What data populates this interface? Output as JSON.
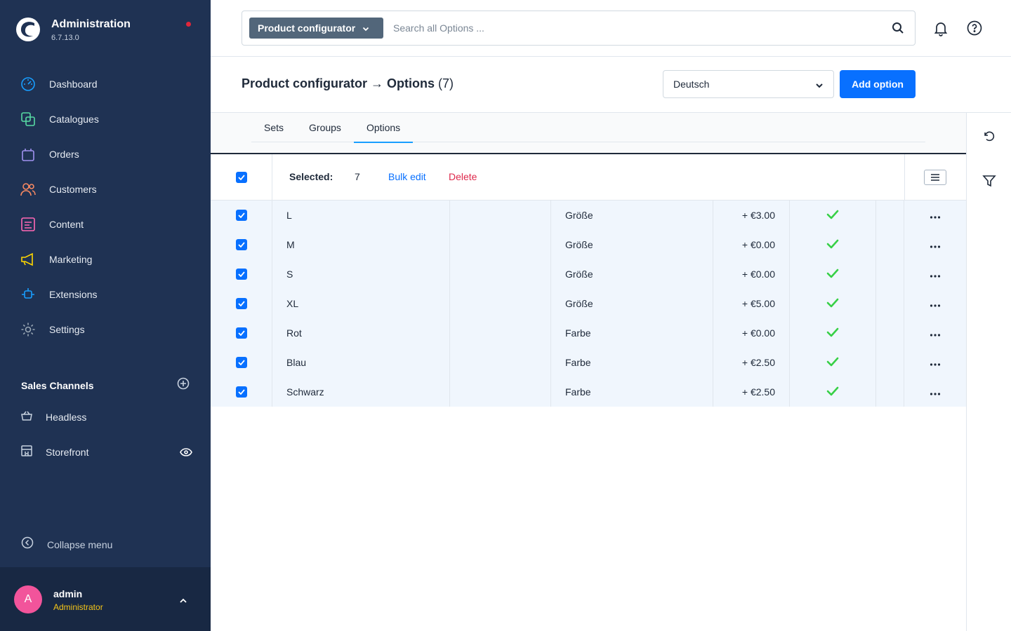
{
  "app": {
    "title": "Administration",
    "version": "6.7.13.0"
  },
  "nav": {
    "items": [
      {
        "label": "Dashboard",
        "icon": "dashboard-icon",
        "color": "#189eff"
      },
      {
        "label": "Catalogues",
        "icon": "catalogue-icon",
        "color": "#57d9a3"
      },
      {
        "label": "Orders",
        "icon": "orders-icon",
        "color": "#a092f0"
      },
      {
        "label": "Customers",
        "icon": "customers-icon",
        "color": "#f88962"
      },
      {
        "label": "Content",
        "icon": "content-icon",
        "color": "#ff68b4"
      },
      {
        "label": "Marketing",
        "icon": "marketing-icon",
        "color": "#ffd700"
      },
      {
        "label": "Extensions",
        "icon": "extensions-icon",
        "color": "#189eff"
      },
      {
        "label": "Settings",
        "icon": "settings-icon",
        "color": "#9aa8b5"
      }
    ]
  },
  "sales_channels": {
    "title": "Sales Channels",
    "items": [
      {
        "label": "Headless",
        "icon": "basket-icon"
      },
      {
        "label": "Storefront",
        "icon": "storefront-icon"
      }
    ]
  },
  "collapse_label": "Collapse menu",
  "user": {
    "initial": "A",
    "name": "admin",
    "role": "Administrator"
  },
  "search": {
    "type_label": "Product configurator",
    "placeholder": "Search all Options ..."
  },
  "smartbar": {
    "title": "Product configurator → Options",
    "count": "(7)",
    "language": "Deutsch",
    "add_label": "Add option"
  },
  "tabs": [
    {
      "label": "Sets",
      "active": false
    },
    {
      "label": "Groups",
      "active": false
    },
    {
      "label": "Options",
      "active": true
    }
  ],
  "bulk": {
    "selected_label": "Selected:",
    "selected_count": "7",
    "edit_label": "Bulk edit",
    "delete_label": "Delete"
  },
  "rows": [
    {
      "name": "L",
      "group": "Größe",
      "price": "+ €3.00",
      "checked": true,
      "active": true
    },
    {
      "name": "M",
      "group": "Größe",
      "price": "+ €0.00",
      "checked": true,
      "active": true
    },
    {
      "name": "S",
      "group": "Größe",
      "price": "+ €0.00",
      "checked": true,
      "active": true
    },
    {
      "name": "XL",
      "group": "Größe",
      "price": "+ €5.00",
      "checked": true,
      "active": true
    },
    {
      "name": "Rot",
      "group": "Farbe",
      "price": "+ €0.00",
      "checked": true,
      "active": true
    },
    {
      "name": "Blau",
      "group": "Farbe",
      "price": "+ €2.50",
      "checked": true,
      "active": true
    },
    {
      "name": "Schwarz",
      "group": "Farbe",
      "price": "+ €2.50",
      "checked": true,
      "active": true
    }
  ],
  "colors": {
    "sidebar": "#1f3253",
    "primary": "#0870ff",
    "danger": "#de294c",
    "success": "#37d046",
    "avatar": "#f2549b",
    "role": "#f5c518"
  }
}
